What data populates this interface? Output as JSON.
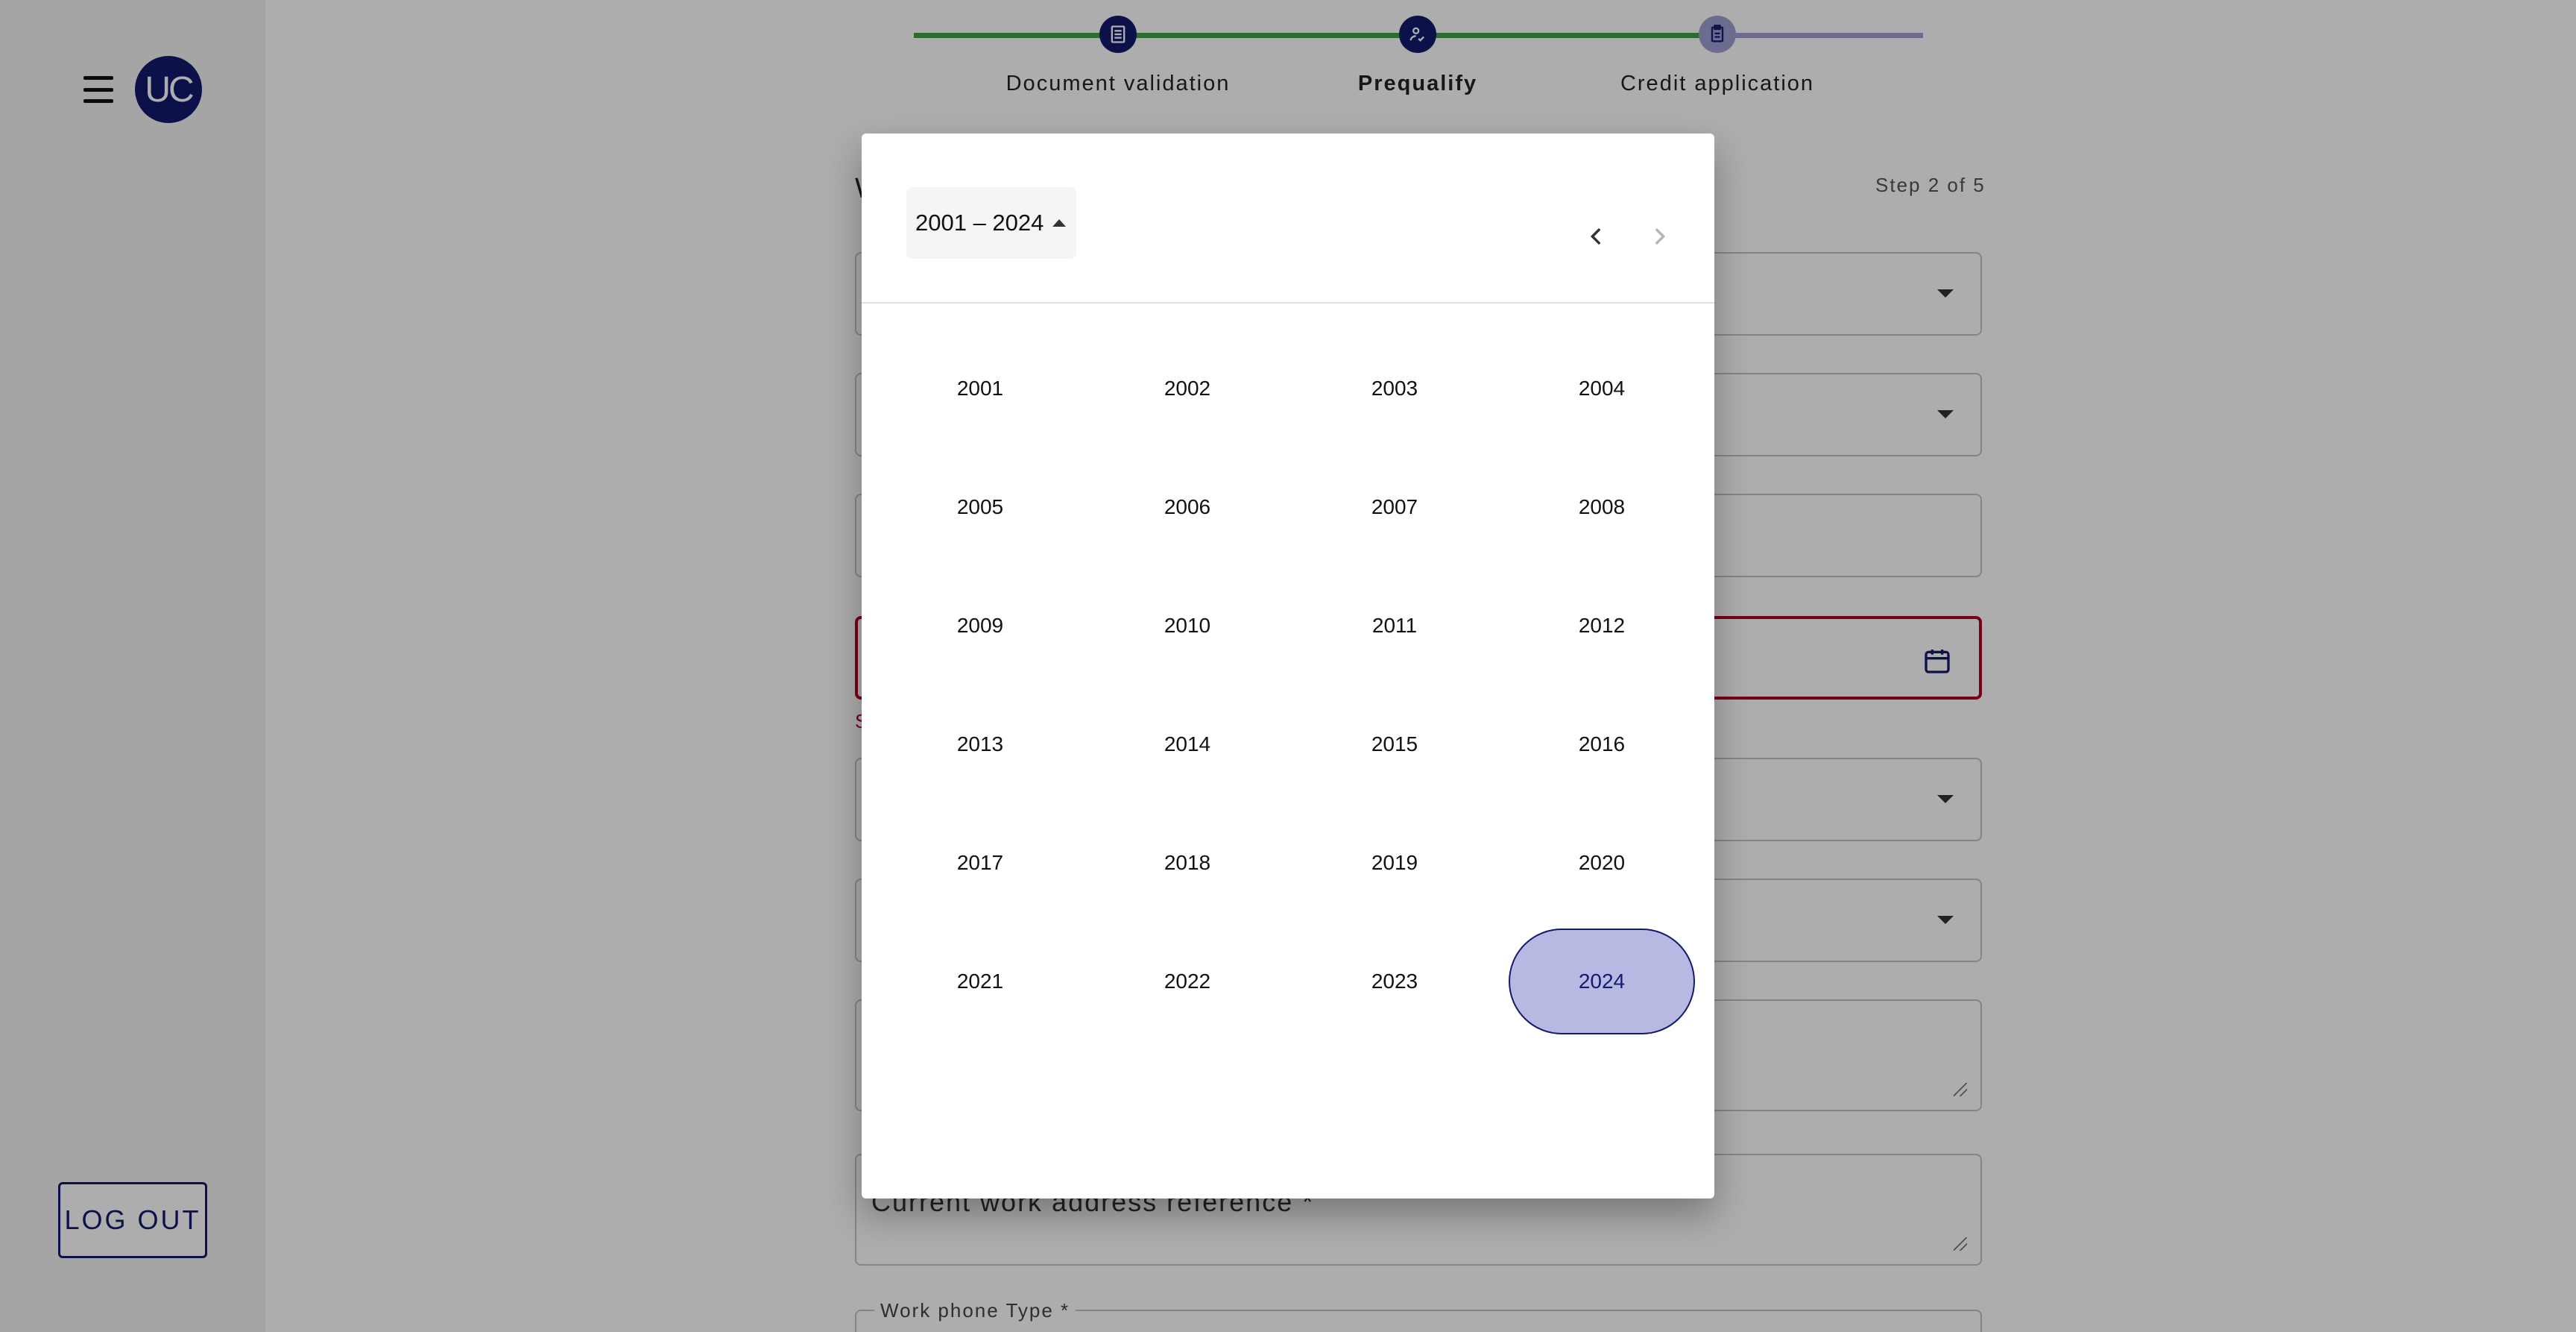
{
  "sidebar": {
    "avatar_initials": "UC",
    "logout_label": "LOG OUT"
  },
  "stepper": {
    "steps": [
      {
        "label": "Document validation",
        "state": "done"
      },
      {
        "label": "Prequalify",
        "state": "active"
      },
      {
        "label": "Credit application",
        "state": "upcoming"
      }
    ],
    "step_count": "Step 2 of 5",
    "colors": {
      "done": "#43a047",
      "active": "#141a6e",
      "upcoming": "#9fa0d6"
    }
  },
  "form": {
    "heading_initial": "W",
    "helper_text_initial": "S",
    "work_address_reference_label": "Current work address reference *",
    "work_phone_type_label": "Work phone Type *"
  },
  "datepicker": {
    "range_label": "2001 – 2024",
    "selected_year": "2024",
    "years": [
      "2001",
      "2002",
      "2003",
      "2004",
      "2005",
      "2006",
      "2007",
      "2008",
      "2009",
      "2010",
      "2011",
      "2012",
      "2013",
      "2014",
      "2015",
      "2016",
      "2017",
      "2018",
      "2019",
      "2020",
      "2021",
      "2022",
      "2023",
      "2024"
    ],
    "prev_icon": "chevron-left-icon",
    "next_icon": "chevron-right-icon",
    "next_disabled": true
  },
  "colors": {
    "brand": "#141a6e",
    "error": "#b00020",
    "selected_fill": "#b7b9e3"
  }
}
